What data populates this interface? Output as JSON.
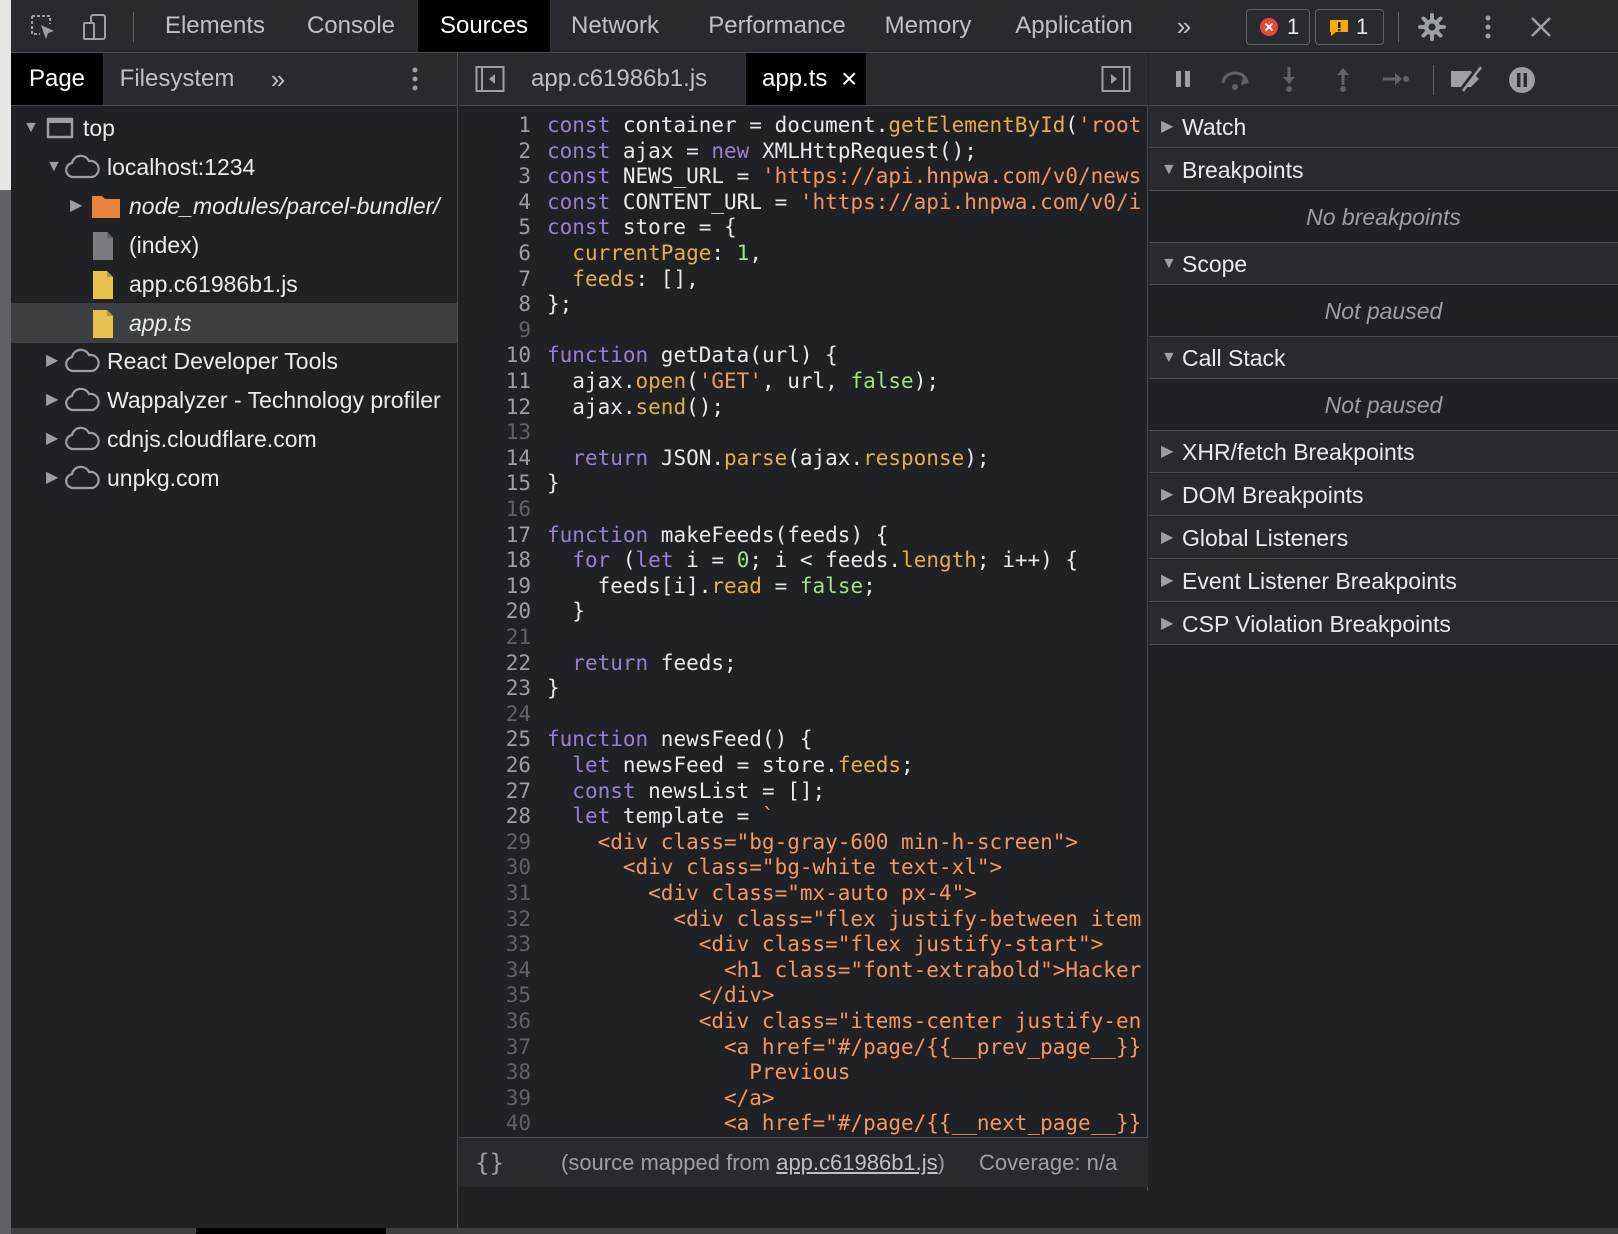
{
  "main_tabs": [
    "Elements",
    "Console",
    "Sources",
    "Network",
    "Performance",
    "Memory",
    "Application"
  ],
  "active_main_tab": "Sources",
  "more_tabs_glyph": "»",
  "error_count": "1",
  "warning_count": "1",
  "navigator": {
    "tabs": [
      "Page",
      "Filesystem"
    ],
    "more_glyph": "»",
    "tree": [
      {
        "label": "top",
        "icon": "frame-icon",
        "expanded": true,
        "level": 0
      },
      {
        "label": "localhost:1234",
        "icon": "cloud-icon",
        "expanded": true,
        "level": 1
      },
      {
        "label": "node_modules/parcel-bundler/",
        "icon": "folder-icon",
        "expanded": false,
        "level": 2,
        "italic": true
      },
      {
        "label": "(index)",
        "icon": "file-icon",
        "level": 2
      },
      {
        "label": "app.c61986b1.js",
        "icon": "file-icon",
        "level": 2
      },
      {
        "label": "app.ts",
        "icon": "file-icon",
        "level": 2,
        "italic": true,
        "selected": true
      },
      {
        "label": "React Developer Tools",
        "icon": "cloud-icon",
        "expanded": false,
        "level": 1
      },
      {
        "label": "Wappalyzer - Technology profiler",
        "icon": "cloud-icon",
        "expanded": false,
        "level": 1
      },
      {
        "label": "cdnjs.cloudflare.com",
        "icon": "cloud-icon",
        "expanded": false,
        "level": 1
      },
      {
        "label": "unpkg.com",
        "icon": "cloud-icon",
        "expanded": false,
        "level": 1
      }
    ]
  },
  "editor": {
    "tabs": [
      {
        "label": "app.c61986b1.js"
      },
      {
        "label": "app.ts",
        "active": true
      }
    ],
    "close_glyph": "×",
    "lines": [
      [
        [
          "k",
          "const"
        ],
        [
          "o",
          " container = document."
        ],
        [
          "p",
          "getElementById"
        ],
        [
          "o",
          "("
        ],
        [
          "s",
          "'root"
        ]
      ],
      [
        [
          "k",
          "const"
        ],
        [
          "o",
          " ajax = "
        ],
        [
          "k",
          "new"
        ],
        [
          "o",
          " XMLHttpRequest();"
        ]
      ],
      [
        [
          "k",
          "const"
        ],
        [
          "o",
          " NEWS_URL = "
        ],
        [
          "s",
          "'https://api.hnpwa.com/v0/news"
        ]
      ],
      [
        [
          "k",
          "const"
        ],
        [
          "o",
          " CONTENT_URL = "
        ],
        [
          "s",
          "'https://api.hnpwa.com/v0/i"
        ]
      ],
      [
        [
          "k",
          "const"
        ],
        [
          "o",
          " store = {"
        ]
      ],
      [
        [
          "o",
          "  "
        ],
        [
          "p",
          "currentPage"
        ],
        [
          "o",
          ": "
        ],
        [
          "n",
          "1"
        ],
        [
          "o",
          ","
        ]
      ],
      [
        [
          "o",
          "  "
        ],
        [
          "p",
          "feeds"
        ],
        [
          "o",
          ": [],"
        ]
      ],
      [
        [
          "o",
          "};"
        ]
      ],
      [],
      [
        [
          "k",
          "function"
        ],
        [
          "o",
          " getData(url) {"
        ]
      ],
      [
        [
          "o",
          "  ajax."
        ],
        [
          "p",
          "open"
        ],
        [
          "o",
          "("
        ],
        [
          "s",
          "'GET'"
        ],
        [
          "o",
          ", url, "
        ],
        [
          "n",
          "false"
        ],
        [
          "o",
          ");"
        ]
      ],
      [
        [
          "o",
          "  ajax."
        ],
        [
          "p",
          "send"
        ],
        [
          "o",
          "();"
        ]
      ],
      [],
      [
        [
          "o",
          "  "
        ],
        [
          "k",
          "return"
        ],
        [
          "o",
          " JSON."
        ],
        [
          "p",
          "parse"
        ],
        [
          "o",
          "(ajax."
        ],
        [
          "p",
          "response"
        ],
        [
          "o",
          ");"
        ]
      ],
      [
        [
          "o",
          "}"
        ]
      ],
      [],
      [
        [
          "k",
          "function"
        ],
        [
          "o",
          " makeFeeds(feeds) {"
        ]
      ],
      [
        [
          "o",
          "  "
        ],
        [
          "k",
          "for"
        ],
        [
          "o",
          " ("
        ],
        [
          "k",
          "let"
        ],
        [
          "o",
          " i = "
        ],
        [
          "n",
          "0"
        ],
        [
          "o",
          "; i < feeds."
        ],
        [
          "p",
          "length"
        ],
        [
          "o",
          "; i++) {"
        ]
      ],
      [
        [
          "o",
          "    feeds[i]."
        ],
        [
          "p",
          "read"
        ],
        [
          "o",
          " = "
        ],
        [
          "n",
          "false"
        ],
        [
          "o",
          ";"
        ]
      ],
      [
        [
          "o",
          "  }"
        ]
      ],
      [],
      [
        [
          "o",
          "  "
        ],
        [
          "k",
          "return"
        ],
        [
          "o",
          " feeds;"
        ]
      ],
      [
        [
          "o",
          "}"
        ]
      ],
      [],
      [
        [
          "k",
          "function"
        ],
        [
          "o",
          " newsFeed() {"
        ]
      ],
      [
        [
          "o",
          "  "
        ],
        [
          "k",
          "let"
        ],
        [
          "o",
          " newsFeed = store."
        ],
        [
          "p",
          "feeds"
        ],
        [
          "o",
          ";"
        ]
      ],
      [
        [
          "o",
          "  "
        ],
        [
          "k",
          "const"
        ],
        [
          "o",
          " newsList = [];"
        ]
      ],
      [
        [
          "o",
          "  "
        ],
        [
          "k",
          "let"
        ],
        [
          "o",
          " template = "
        ],
        [
          "s",
          "`"
        ]
      ],
      [
        [
          "s",
          "    <div class=\"bg-gray-600 min-h-screen\">"
        ]
      ],
      [
        [
          "s",
          "      <div class=\"bg-white text-xl\">"
        ]
      ],
      [
        [
          "s",
          "        <div class=\"mx-auto px-4\">"
        ]
      ],
      [
        [
          "s",
          "          <div class=\"flex justify-between item"
        ]
      ],
      [
        [
          "s",
          "            <div class=\"flex justify-start\">"
        ]
      ],
      [
        [
          "s",
          "              <h1 class=\"font-extrabold\">Hacker"
        ]
      ],
      [
        [
          "s",
          "            </div>"
        ]
      ],
      [
        [
          "s",
          "            <div class=\"items-center justify-en"
        ]
      ],
      [
        [
          "s",
          "              <a href=\"#/page/{{__prev_page__}}"
        ]
      ],
      [
        [
          "s",
          "                Previous"
        ]
      ],
      [
        [
          "s",
          "              </a>"
        ]
      ],
      [
        [
          "s",
          "              <a href=\"#/page/{{__next_page__}}"
        ]
      ]
    ]
  },
  "status": {
    "pretty_print_glyph": "{}",
    "source_mapped_prefix": "(source mapped from ",
    "source_mapped_link": "app.c61986b1.js",
    "source_mapped_suffix": ")",
    "coverage": "Coverage: n/a"
  },
  "debugger": {
    "panes": [
      {
        "title": "Watch",
        "expanded": false
      },
      {
        "title": "Breakpoints",
        "expanded": true,
        "message": "No breakpoints"
      },
      {
        "title": "Scope",
        "expanded": true,
        "message": "Not paused"
      },
      {
        "title": "Call Stack",
        "expanded": true,
        "message": "Not paused"
      },
      {
        "title": "XHR/fetch Breakpoints",
        "expanded": false
      },
      {
        "title": "DOM Breakpoints",
        "expanded": false
      },
      {
        "title": "Global Listeners",
        "expanded": false
      },
      {
        "title": "Event Listener Breakpoints",
        "expanded": false
      },
      {
        "title": "CSP Violation Breakpoints",
        "expanded": false
      }
    ]
  },
  "colors": {
    "keyword": "#9a7fd5",
    "string": "#f29766",
    "property": "#e0b04a",
    "literal": "#a1e283",
    "background": "#202124",
    "toolbar": "#292a2d",
    "error": "#e8453c",
    "warning": "#f9ab00"
  }
}
